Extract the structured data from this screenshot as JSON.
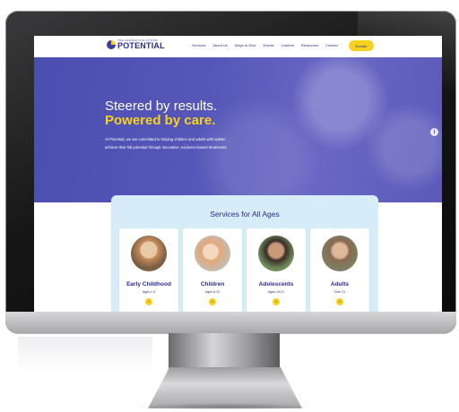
{
  "site": {
    "logo": {
      "small": "THE CENTER FOR AUTISM",
      "big": "POTENTIAL"
    },
    "nav": [
      "Services",
      "About Us",
      "Ways to Give",
      "Events",
      "Careers",
      "Resources",
      "Contact"
    ],
    "donate_label": "Donate",
    "hero": {
      "title_line1": "Steered by results.",
      "title_line2": "Powered by care.",
      "body": "At Potential, we are committed to helping children and adults with autism achieve their full potential through innovative, evidence-based treatments.",
      "info_icon": "i"
    },
    "services": {
      "title": "Services for All Ages",
      "cards": [
        {
          "title": "Early Childhood",
          "ages": "Ages 1-5",
          "arrow": "›"
        },
        {
          "title": "Children",
          "ages": "Ages 6-12",
          "arrow": "›"
        },
        {
          "title": "Adolescents",
          "ages": "Ages 13-21",
          "arrow": "›"
        },
        {
          "title": "Adults",
          "ages": "Over 21",
          "arrow": "›"
        }
      ]
    }
  },
  "colors": {
    "brand_navy": "#2d2a8a",
    "brand_yellow": "#f6d21f",
    "hero_blue": "#5556b8",
    "card_bg": "#d6edf9"
  }
}
